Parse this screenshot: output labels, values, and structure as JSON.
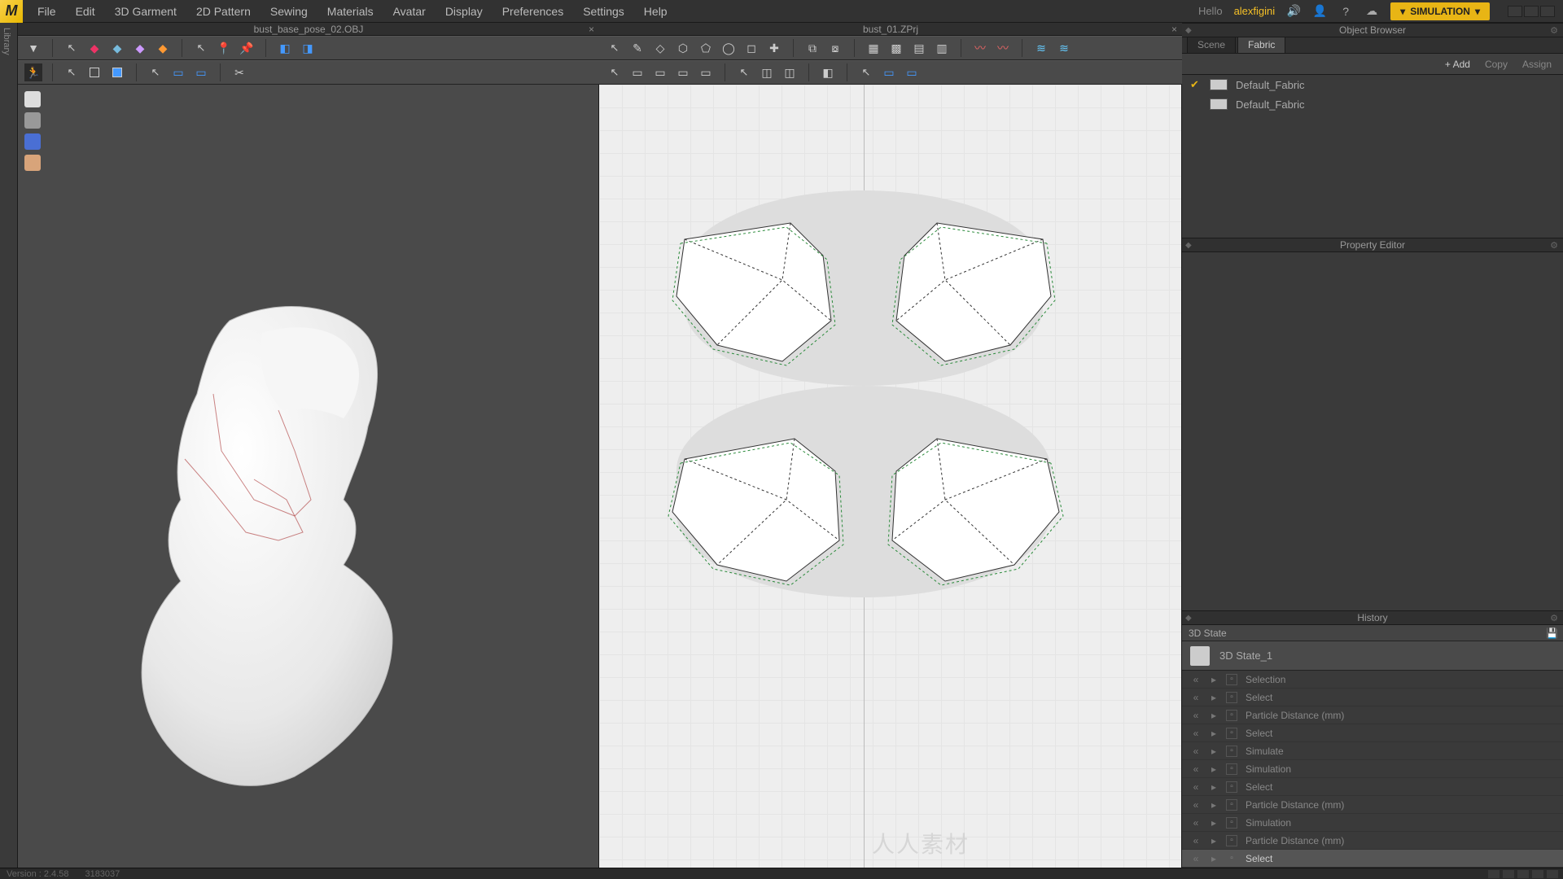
{
  "menu": {
    "items": [
      "File",
      "Edit",
      "3D Garment",
      "2D Pattern",
      "Sewing",
      "Materials",
      "Avatar",
      "Display",
      "Preferences",
      "Settings",
      "Help"
    ]
  },
  "top": {
    "hello": "Hello",
    "user": "alexfigini",
    "simulation": "SIMULATION"
  },
  "tabs": {
    "left": "bust_base_pose_02.OBJ",
    "mid": "bust_01.ZPrj"
  },
  "rightPanels": {
    "objectBrowser": "Object Browser",
    "propertyEditor": "Property Editor",
    "history": "History"
  },
  "rightTabs": {
    "scene": "Scene",
    "fabric": "Fabric"
  },
  "browserActions": {
    "add": "+ Add",
    "copy": "Copy",
    "assign": "Assign"
  },
  "fabrics": [
    {
      "checked": true,
      "name": "Default_Fabric"
    },
    {
      "checked": false,
      "name": "Default_Fabric"
    }
  ],
  "history": {
    "header": "3D State",
    "stateName": "3D State_1",
    "items": [
      {
        "label": "Selection",
        "sel": false
      },
      {
        "label": "Select",
        "sel": false
      },
      {
        "label": "Particle Distance (mm)",
        "sel": false
      },
      {
        "label": "Select",
        "sel": false
      },
      {
        "label": "Simulate",
        "sel": false
      },
      {
        "label": "Simulation",
        "sel": false
      },
      {
        "label": "Select",
        "sel": false
      },
      {
        "label": "Particle Distance (mm)",
        "sel": false
      },
      {
        "label": "Simulation",
        "sel": false
      },
      {
        "label": "Particle Distance (mm)",
        "sel": false
      },
      {
        "label": "Select",
        "sel": true
      }
    ]
  },
  "status": {
    "version": "Version : 2.4.58",
    "code": "3183037"
  },
  "watermark": "人人素材"
}
